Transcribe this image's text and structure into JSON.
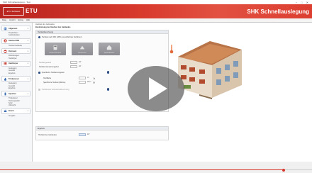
{
  "window": {
    "title": "SHK Schnellauslegung - Test",
    "controls": [
      "−",
      "□",
      "✕"
    ]
  },
  "banner": {
    "logo_text": "ETU Software",
    "company": "ETU",
    "product": "SHK Schnellauslegung"
  },
  "menu": {
    "items": [
      "Datei",
      "Ansicht",
      "Extras",
      "Hilfe"
    ]
  },
  "sidebar": {
    "sections": [
      {
        "label": "Allgemein",
        "icon": "globe-icon",
        "color": "#3a6fb6",
        "items": [
          "Projektdaten",
          "Gebäudedaten"
        ]
      },
      {
        "label": "Heizlast DIN",
        "icon": "heat-icon",
        "color": "#c8382c",
        "items": [
          "Heizlast Gebäude"
        ]
      },
      {
        "label": "Rohrnetz",
        "icon": "pipe-icon",
        "color": "#c8382c",
        "items": [
          "Rohrleitungen",
          "Heizkörper"
        ]
      },
      {
        "label": "Heizkörper",
        "icon": "radiator-icon",
        "color": "#c8382c",
        "items": [
          "Auslegung",
          "Auswahl",
          "Ergebnis"
        ]
      },
      {
        "label": "Trinkwasser",
        "icon": "water-icon",
        "color": "#3a6fb6",
        "items": [
          "Auslegung",
          "Auswahl",
          "Ergebnis"
        ]
      },
      {
        "label": "Speicher",
        "icon": "tank-icon",
        "color": "#3a6fb6",
        "items": [
          "Trinkwasser",
          "Heizungspuffer",
          "Solar",
          "Übersicht"
        ]
      },
      {
        "label": "Druck",
        "icon": "print-icon",
        "color": "#3a6fb6",
        "items": [
          "Ausgabe"
        ]
      }
    ]
  },
  "breadcrumb": {
    "line1": "Heizlast des Gebäudes",
    "line2": "Bestimmung der Heizlast des Gebäudes"
  },
  "form": {
    "header": "Heizlastberechnung",
    "option1": "Heizlast nach DIN 12831 (vereinfachtes Verfahren)",
    "tiles": [
      "Heizlast-Rechner",
      "Raumweise",
      "Gebäudedaten"
    ],
    "field1_label": "Heizlast gesamt",
    "field1_unit": "kW",
    "field2_label": "Heizlast manuell eingeben",
    "field2_unit": "kW",
    "option2": "Spezifische Heizlast eingeben",
    "field3_label": "Heizfläche",
    "field3_unit": "m²",
    "field4_label": "Spezifische Heizlast (Wärme)",
    "field4_unit": "W/m²",
    "option3": "Heizlast aus Verbrauchsabrechnung"
  },
  "egroup": {
    "header": "Ergebnis",
    "label": "Heizlast des Gebäudes",
    "unit": "kW"
  },
  "video": {
    "played_fraction": 0.91,
    "accent": "#d8352a"
  }
}
